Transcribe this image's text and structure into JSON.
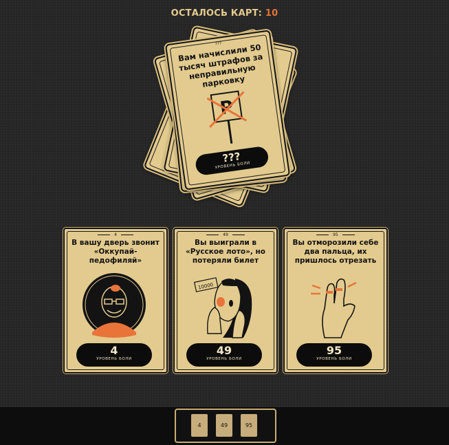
{
  "header": {
    "label": "ОСТАЛОСЬ КАРТ:",
    "count": "10"
  },
  "deck_top": {
    "question": "Вам начислили 50 тысяч штрафов за неправильную парковку",
    "badge": "???",
    "pain_value": "???",
    "pain_label": "УРОВЕНЬ БОЛИ",
    "parking_letter": "P"
  },
  "choices": [
    {
      "badge": "4",
      "title": "В вашу дверь звонит «Оккупай-педофиляй»",
      "pain_value": "4",
      "pain_label": "УРОВЕНЬ БОЛИ",
      "icon": "bald-man-glasses-icon"
    },
    {
      "badge": "49",
      "title": "Вы выиграли в «Русское лото», но потеряли билет",
      "pain_value": "49",
      "pain_label": "УРОВЕНЬ БОЛИ",
      "icon": "shocked-woman-icon",
      "ticket_text": "10000"
    },
    {
      "badge": "95",
      "title": "Вы отморозили себе два пальца, их пришлось отрезать",
      "pain_value": "95",
      "pain_label": "УРОВЕНЬ БОЛИ",
      "icon": "hand-two-fingers-icon"
    }
  ],
  "slots": [
    "4",
    "49",
    "95"
  ],
  "colors": {
    "card": "#e3cb8f",
    "accent": "#e8743a",
    "background": "#262626"
  }
}
